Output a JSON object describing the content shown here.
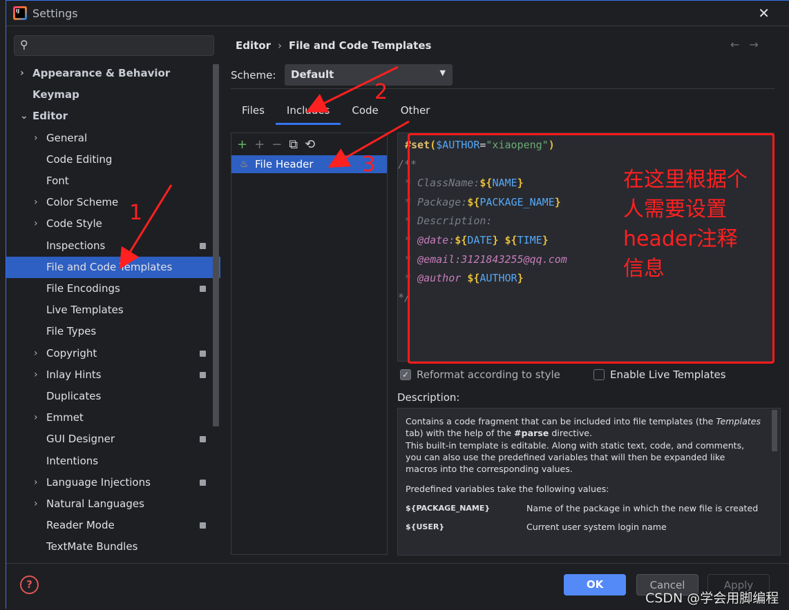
{
  "window": {
    "title": "Settings",
    "close_icon": "close-icon"
  },
  "search": {
    "placeholder": ""
  },
  "sidebar": {
    "items": [
      {
        "label": "Appearance & Behavior",
        "level": 0,
        "chevron": "right",
        "bold": true
      },
      {
        "label": "Keymap",
        "level": 0,
        "bold": true
      },
      {
        "label": "Editor",
        "level": 0,
        "chevron": "down",
        "bold": true
      },
      {
        "label": "General",
        "level": 1,
        "chevron": "right"
      },
      {
        "label": "Code Editing",
        "level": 1
      },
      {
        "label": "Font",
        "level": 1
      },
      {
        "label": "Color Scheme",
        "level": 1,
        "chevron": "right"
      },
      {
        "label": "Code Style",
        "level": 1,
        "chevron": "right"
      },
      {
        "label": "Inspections",
        "level": 1,
        "badge": true
      },
      {
        "label": "File and Code Templates",
        "level": 1,
        "selected": true
      },
      {
        "label": "File Encodings",
        "level": 1,
        "badge": true
      },
      {
        "label": "Live Templates",
        "level": 1
      },
      {
        "label": "File Types",
        "level": 1
      },
      {
        "label": "Copyright",
        "level": 1,
        "chevron": "right",
        "badge": true
      },
      {
        "label": "Inlay Hints",
        "level": 1,
        "chevron": "right",
        "badge": true
      },
      {
        "label": "Duplicates",
        "level": 1
      },
      {
        "label": "Emmet",
        "level": 1,
        "chevron": "right"
      },
      {
        "label": "GUI Designer",
        "level": 1,
        "badge": true
      },
      {
        "label": "Intentions",
        "level": 1
      },
      {
        "label": "Language Injections",
        "level": 1,
        "chevron": "right",
        "badge": true
      },
      {
        "label": "Natural Languages",
        "level": 1,
        "chevron": "right"
      },
      {
        "label": "Reader Mode",
        "level": 1,
        "badge": true
      },
      {
        "label": "TextMate Bundles",
        "level": 1
      }
    ]
  },
  "breadcrumb": [
    "Editor",
    "File and Code Templates"
  ],
  "scheme": {
    "label": "Scheme:",
    "value": "Default"
  },
  "tabs": [
    {
      "label": "Files"
    },
    {
      "label": "Includes",
      "active": true
    },
    {
      "label": "Code"
    },
    {
      "label": "Other"
    }
  ],
  "templates": {
    "items": [
      "File Header"
    ]
  },
  "editor": {
    "lines": [
      [
        [
          "k",
          "#set"
        ],
        [
          "d",
          "("
        ],
        [
          "v",
          "$AUTHOR"
        ],
        [
          "p",
          "="
        ],
        [
          "s",
          "\"xiaopeng\""
        ],
        [
          "d",
          ")"
        ]
      ],
      [
        [
          "c",
          "/**"
        ]
      ],
      [
        [
          "c",
          "* ClassName:"
        ],
        [
          "d",
          "${"
        ],
        [
          "v",
          "NAME"
        ],
        [
          "d",
          "}"
        ]
      ],
      [
        [
          "c",
          "* Package:"
        ],
        [
          "d",
          "${"
        ],
        [
          "v",
          "PACKAGE_NAME"
        ],
        [
          "d",
          "}"
        ]
      ],
      [
        [
          "c",
          "* Description:"
        ]
      ],
      [
        [
          "c",
          "* "
        ],
        [
          "t",
          "@date:"
        ],
        [
          "d",
          "${"
        ],
        [
          "v",
          "DATE"
        ],
        [
          "d",
          "}"
        ],
        [
          "p",
          " "
        ],
        [
          "d",
          "${"
        ],
        [
          "v",
          "TIME"
        ],
        [
          "d",
          "}"
        ]
      ],
      [
        [
          "c",
          "* "
        ],
        [
          "t",
          "@email:3121843255@qq.com"
        ]
      ],
      [
        [
          "c",
          "* "
        ],
        [
          "t",
          "@author"
        ],
        [
          "p",
          " "
        ],
        [
          "d",
          "${"
        ],
        [
          "v",
          "AUTHOR"
        ],
        [
          "d",
          "}"
        ]
      ],
      [
        [
          "c",
          "*/"
        ]
      ]
    ]
  },
  "options": {
    "reformat": {
      "label": "Reformat according to style",
      "checked": true
    },
    "live": {
      "label": "Enable Live Templates",
      "checked": false
    }
  },
  "description": {
    "label": "Description:",
    "p1a": "Contains a code fragment that can be included into file templates (the ",
    "p1b": "Templates",
    "p1c": " tab) with the help of the ",
    "p1d": "#parse",
    "p1e": " directive.",
    "p2": "This built-in template is editable. Along with static text, code, and comments, you can also use the predefined variables that will then be expanded like macros into the corresponding values.",
    "p3": "Predefined variables take the following values:",
    "vars": [
      {
        "name": "${PACKAGE_NAME}",
        "desc": "Name of the package in which the new file is created"
      },
      {
        "name": "${USER}",
        "desc": "Current user system login name"
      }
    ]
  },
  "buttons": {
    "ok": "OK",
    "cancel": "Cancel",
    "apply": "Apply"
  },
  "annotations": {
    "note": "在这里根据个人需要设置header注释信息",
    "n1": "1",
    "n2": "2",
    "n3": "3",
    "color": "#ff2020"
  },
  "watermark": "CSDN @学会用脚编程"
}
